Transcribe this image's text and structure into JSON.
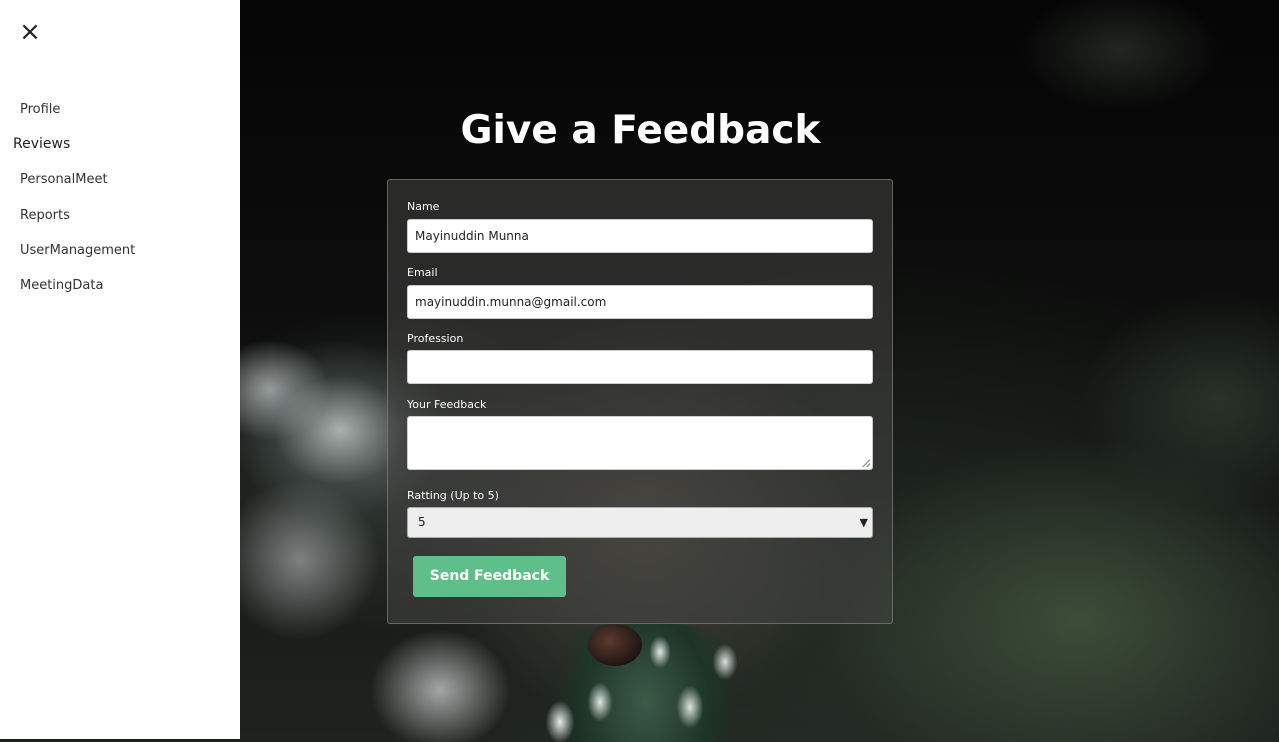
{
  "sidebar": {
    "close_icon": "×",
    "items": [
      {
        "label": "Profile"
      },
      {
        "label": "Reviews"
      },
      {
        "label": "PersonalMeet"
      },
      {
        "label": "Reports"
      },
      {
        "label": "UserManagement"
      },
      {
        "label": "MeetingData"
      }
    ]
  },
  "main": {
    "title": "Give a Feedback",
    "form": {
      "name_label": "Name",
      "name_value": "Mayinuddin Munna",
      "email_label": "Email",
      "email_value": "mayinuddin.munna@gmail.com",
      "profession_label": "Profession",
      "profession_value": "",
      "feedback_label": "Your Feedback",
      "feedback_value": "",
      "rating_label": "Ratting (Up to 5)",
      "rating_value": "5",
      "submit_label": "Send Feedback"
    }
  },
  "colors": {
    "submit_button": "#5fbf8b",
    "sidebar_bg": "#ffffff"
  }
}
